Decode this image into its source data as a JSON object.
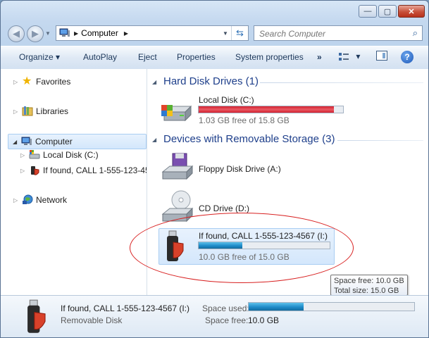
{
  "window": {
    "caption_buttons": {
      "minimize": "—",
      "maximize": "▢",
      "close": "✕"
    }
  },
  "address": {
    "path": "Computer"
  },
  "search": {
    "placeholder": "Search Computer"
  },
  "toolbar": {
    "organize": "Organize ▾",
    "autoplay": "AutoPlay",
    "eject": "Eject",
    "properties": "Properties",
    "system_properties": "System properties",
    "more": "»",
    "views": "▾"
  },
  "nav": {
    "favorites": "Favorites",
    "libraries": "Libraries",
    "computer": "Computer",
    "local_disk": "Local Disk (C:)",
    "usb_drive": "If found, CALL 1-555-123-4567 (I:)",
    "network": "Network"
  },
  "groups": {
    "hard_disks": "Hard Disk Drives (1)",
    "removable": "Devices with Removable Storage (3)"
  },
  "drives": {
    "local": {
      "name": "Local Disk (C:)",
      "free": "1.03 GB free of 15.8 GB",
      "used_fraction": 0.935,
      "bar_color": "#d3202f"
    },
    "floppy": {
      "name": "Floppy Disk Drive (A:)"
    },
    "cd": {
      "name": "CD Drive (D:)"
    },
    "usb": {
      "name": "If found, CALL 1-555-123-4567 (I:)",
      "free": "10.0 GB free of 15.0 GB",
      "used_fraction": 0.333,
      "bar_color": "#1e8bc9"
    }
  },
  "tooltip": {
    "space_free": "Space free: 10.0 GB",
    "total_size": "Total size: 15.0 GB"
  },
  "details": {
    "name": "If found, CALL 1-555-123-4567 (I:)",
    "type": "Removable Disk",
    "space_used_label": "Space used:",
    "space_free_label": "Space free:",
    "space_free_value": "10.0 GB",
    "used_fraction": 0.333
  },
  "colors": {
    "accent": "#1e3f8b",
    "selection": "#d4e7fc",
    "annotation": "#d82020"
  }
}
